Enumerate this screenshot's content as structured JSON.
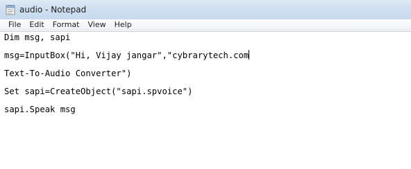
{
  "window": {
    "title": "audio - Notepad",
    "icon": "notepad-icon"
  },
  "menu": {
    "items": [
      "File",
      "Edit",
      "Format",
      "View",
      "Help"
    ]
  },
  "editor": {
    "lines": [
      "Dim msg, sapi",
      "msg=InputBox(\"Hi, Vijay jangar\",\"cybrarytech.com",
      "Text-To-Audio Converter\")",
      "Set sapi=CreateObject(\"sapi.spvoice\")",
      "sapi.Speak msg"
    ]
  },
  "colors": {
    "titlebar": "#cfdff0",
    "text": "#000000"
  }
}
